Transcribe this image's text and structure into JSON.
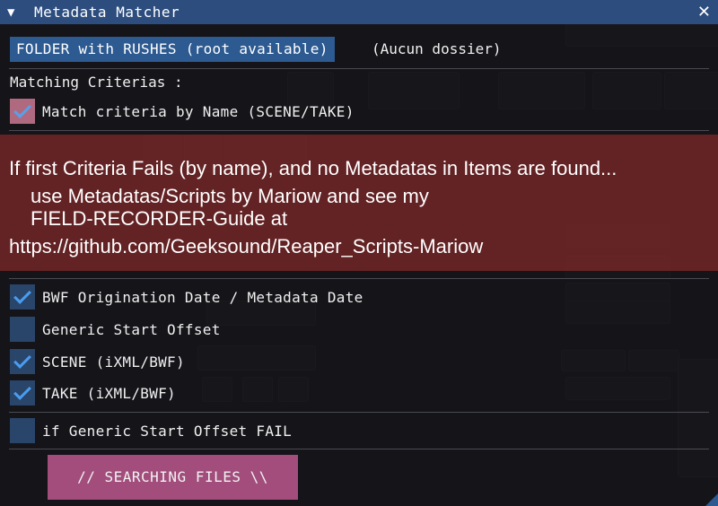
{
  "window": {
    "title": "Metadata Matcher",
    "collapse_icon": "▼",
    "close_icon": "✕"
  },
  "folder": {
    "button_label": "FOLDER with RUSHES (root available)",
    "status": "(Aucun dossier)"
  },
  "criteria": {
    "heading": "Matching Criterias :",
    "by_name": {
      "label": "Match criteria by Name (SCENE/TAKE)",
      "checked": true
    }
  },
  "info": {
    "line1": "If first Criteria Fails (by name), and no Metadatas in Items are found...",
    "line2": "use Metadatas/Scripts by Mariow and see my",
    "line3": "FIELD-RECORDER-Guide at",
    "line4": "https://github.com/Geeksound/Reaper_Scripts-Mariow"
  },
  "options": [
    {
      "label": "BWF Origination Date / Metadata Date",
      "checked": true
    },
    {
      "label": "Generic Start Offset",
      "checked": false
    },
    {
      "label": "SCENE (iXML/BWF)",
      "checked": true
    },
    {
      "label": "TAKE (iXML/BWF)",
      "checked": true
    }
  ],
  "fallback": {
    "label": "if Generic Start Offset FAIL",
    "checked": false
  },
  "search_button": {
    "label": "//  SEARCHING FILES  \\\\"
  },
  "colors": {
    "titlebar": "#2c4d7e",
    "accent": "#2c5a91",
    "checkbox_bg": "#29456a",
    "checkmark": "#4a9cf0",
    "info_band": "#822828",
    "search_button": "#a24d7c"
  }
}
